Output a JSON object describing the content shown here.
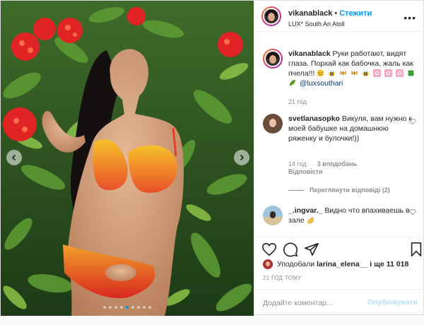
{
  "post": {
    "username": "vikanablack",
    "separator": "•",
    "follow_label": "Стежити",
    "location": "LUX* South Ari Atoll",
    "more_label": "•••"
  },
  "caption": {
    "username": "vikanablack",
    "text": " Руки работают, видят глаза. Порхай как бабочка, жаль как пчела!!!",
    "mention": "@luxsouthari",
    "time": "21 год."
  },
  "comment": {
    "username": "svetlanasopko",
    "text": " Викуля, вам нужно к моей бабушке на домашнюю ряженку и булочки!))",
    "time": "14 год.",
    "likes": "3 вподобань",
    "reply_label": "Відповісти",
    "view_replies": "Переглянути відповіді (2)"
  },
  "comment2": {
    "username": "_.ingvar._",
    "text": " Видно что впахиваешь в зале"
  },
  "likes": {
    "prefix": "Уподобали ",
    "liker": "larina_elena__",
    "suffix": " і ще 11 018"
  },
  "posted": "21 ГОД ТОМУ",
  "add_comment": {
    "placeholder": "Додайте коментар...",
    "publish_label": "Опублікувати"
  },
  "carousel": {
    "slides": 9,
    "active_index": 4
  },
  "colors": {
    "accent": "#0095f6",
    "publish_disabled": "#b2dffc",
    "muted": "#8e8e8e",
    "bikini_top": "#f0a020",
    "bikini_bottom": "#e8402a",
    "flowers": "#e02424"
  },
  "icons": {
    "prev": "chevron-left-icon",
    "next": "chevron-right-icon",
    "like": "heart-icon",
    "comment": "comment-icon",
    "share": "paper-plane-icon",
    "save": "bookmark-icon",
    "more": "ellipsis-icon"
  }
}
